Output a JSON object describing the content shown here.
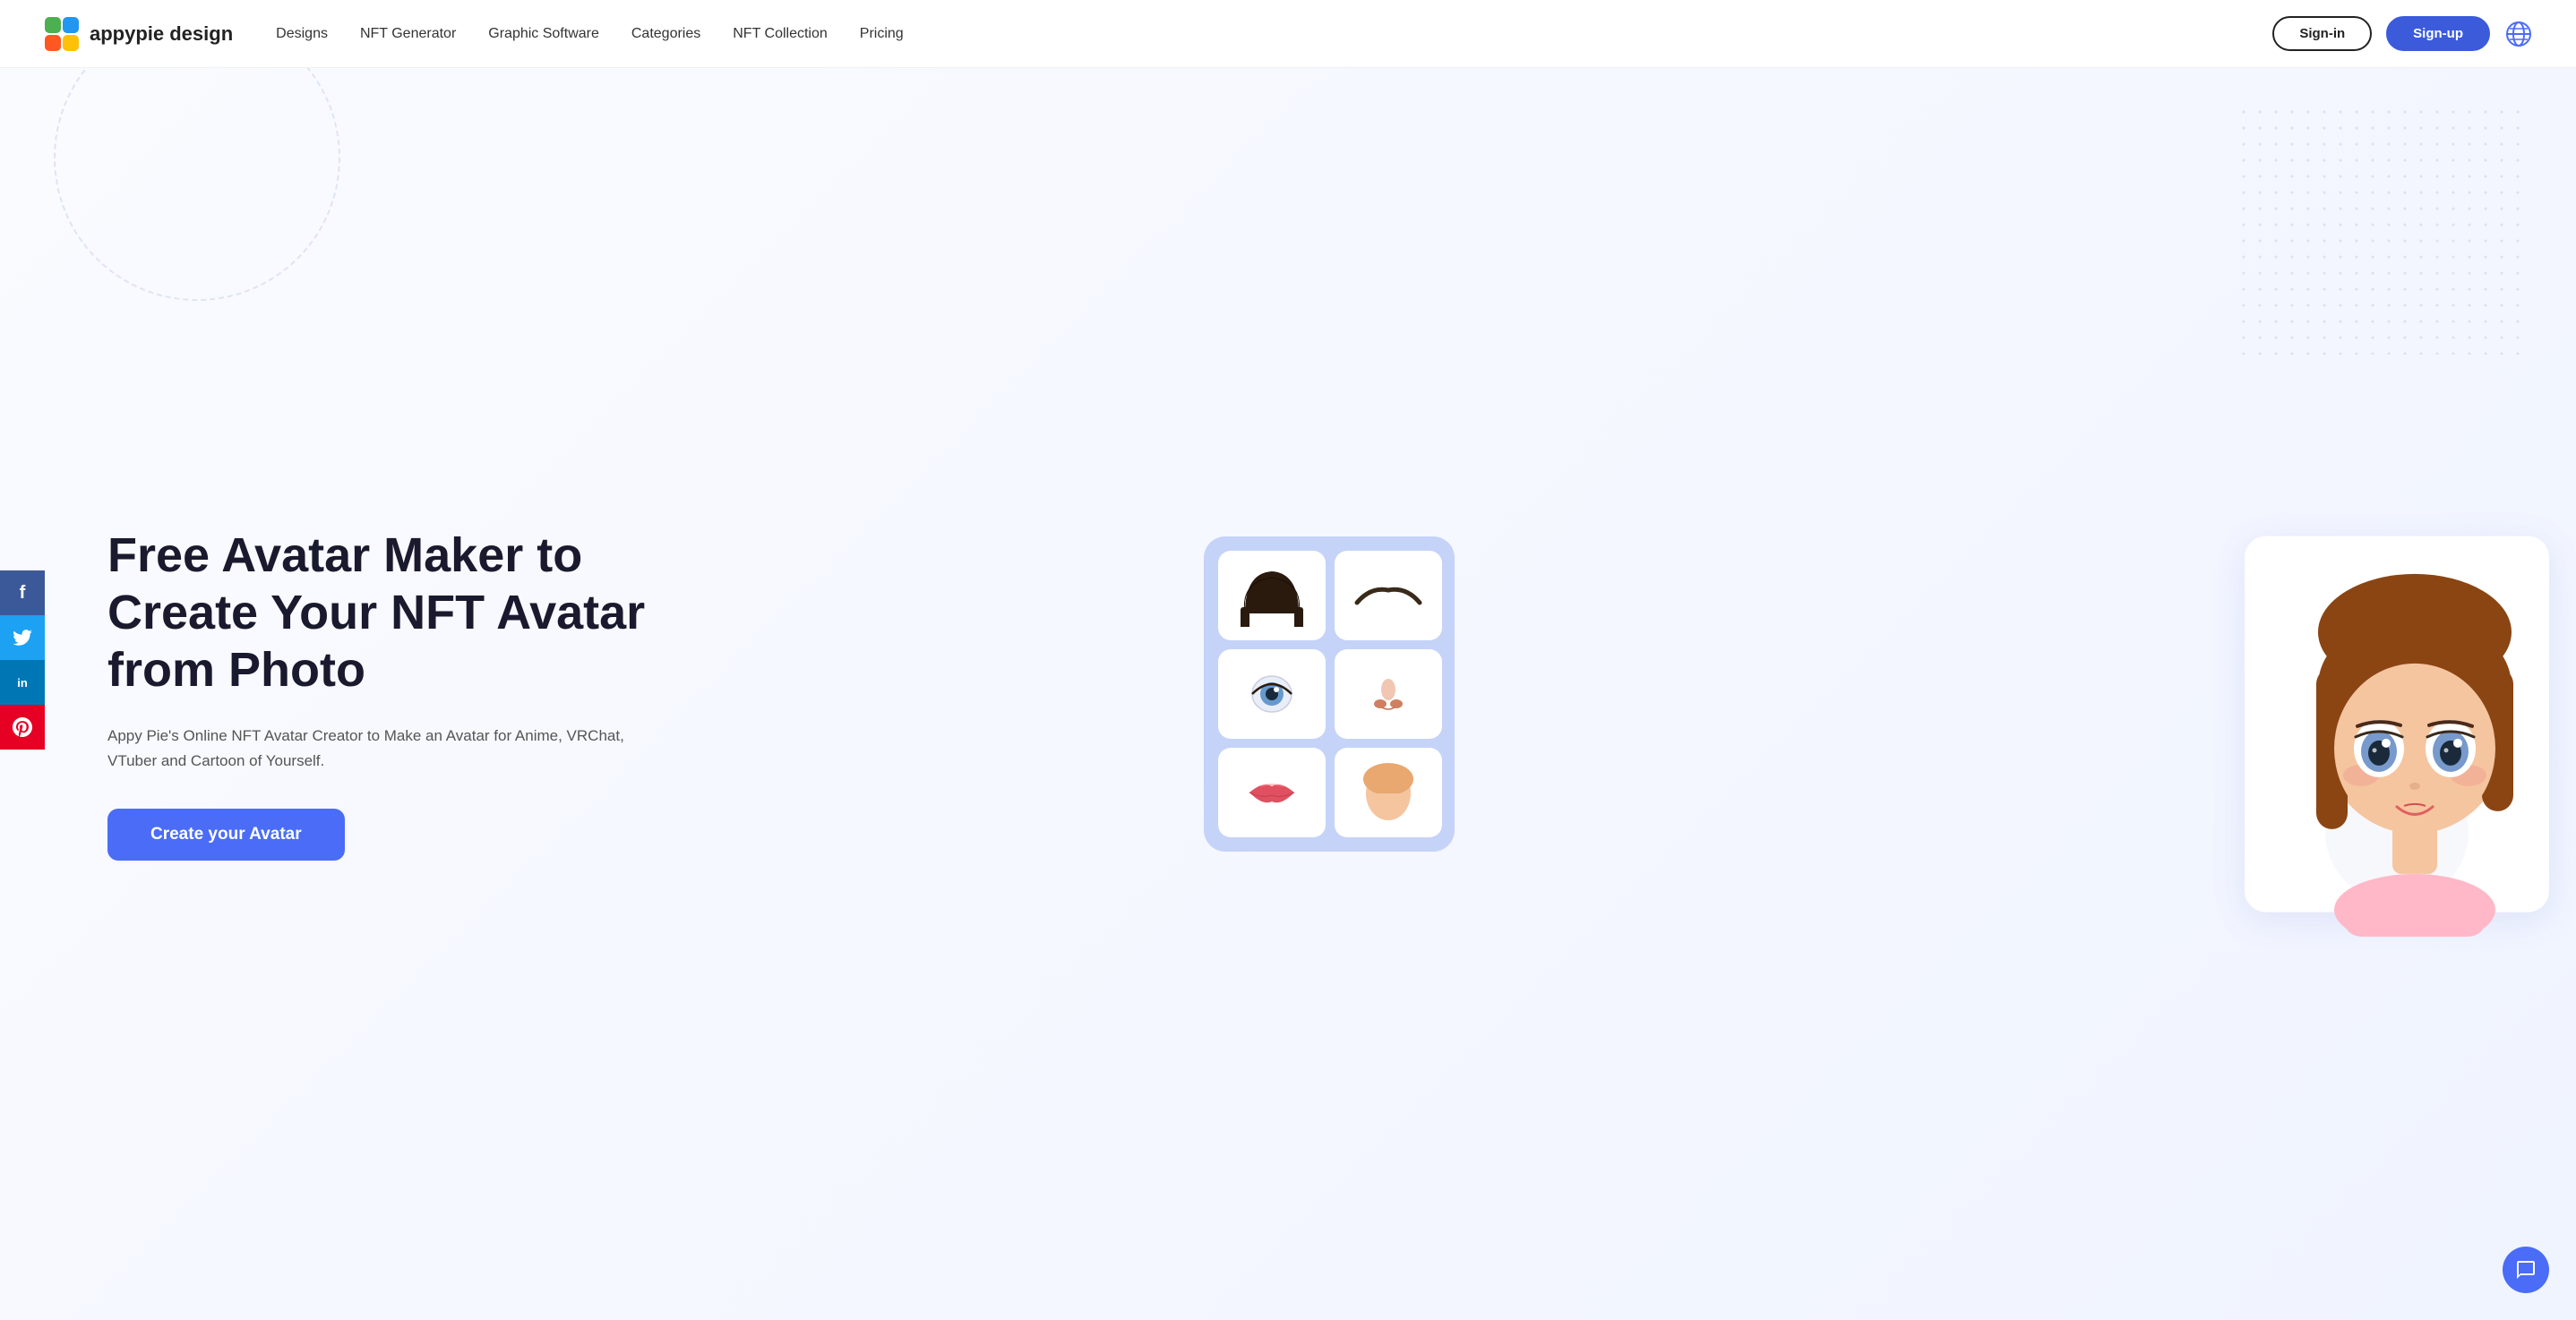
{
  "logo": {
    "text": "appypie design"
  },
  "nav": {
    "links": [
      {
        "id": "designs",
        "label": "Designs"
      },
      {
        "id": "nft-generator",
        "label": "NFT Generator"
      },
      {
        "id": "graphic-software",
        "label": "Graphic Software"
      },
      {
        "id": "categories",
        "label": "Categories"
      },
      {
        "id": "nft-collection",
        "label": "NFT Collection"
      },
      {
        "id": "pricing",
        "label": "Pricing"
      }
    ],
    "signin_label": "Sign-in",
    "signup_label": "Sign-up"
  },
  "hero": {
    "title": "Free Avatar Maker to Create Your NFT Avatar from Photo",
    "subtitle": "Appy Pie's Online NFT Avatar Creator to Make an Avatar for Anime, VRChat, VTuber and Cartoon of Yourself.",
    "cta_label": "Create your Avatar"
  },
  "social": {
    "items": [
      {
        "id": "facebook",
        "symbol": "f",
        "label": "Facebook"
      },
      {
        "id": "twitter",
        "symbol": "t",
        "label": "Twitter"
      },
      {
        "id": "linkedin",
        "symbol": "in",
        "label": "LinkedIn"
      },
      {
        "id": "pinterest",
        "symbol": "P",
        "label": "Pinterest"
      }
    ]
  },
  "chat": {
    "label": "Chat"
  }
}
